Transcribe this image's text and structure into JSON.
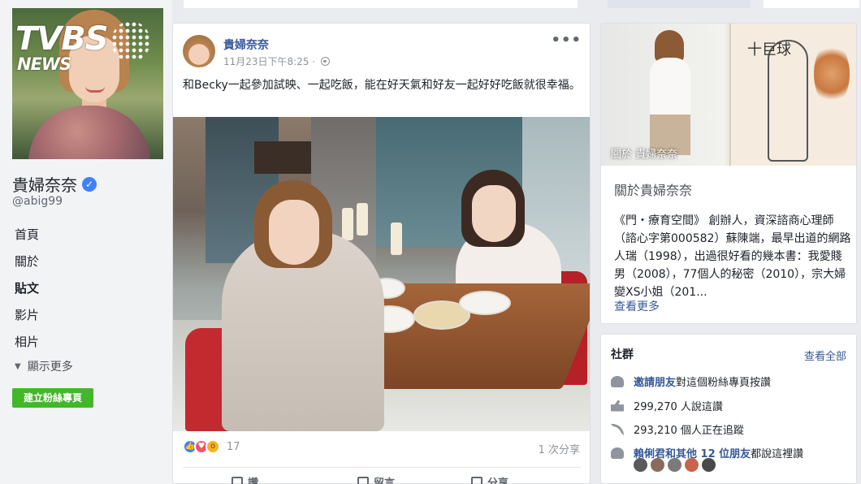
{
  "cover": {
    "logo_main": "TVBS",
    "logo_sub": "NEWS"
  },
  "page": {
    "name": "貴婦奈奈",
    "verified_icon": "check",
    "handle": "@abig99"
  },
  "nav": {
    "items": [
      {
        "label": "首頁",
        "active": false
      },
      {
        "label": "關於",
        "active": false
      },
      {
        "label": "貼文",
        "active": true
      },
      {
        "label": "影片",
        "active": false
      },
      {
        "label": "相片",
        "active": false
      }
    ],
    "see_more": "顯示更多",
    "create_page": "建立粉絲專頁"
  },
  "post": {
    "author": "貴婦奈奈",
    "time": "11月23日下午8:25 ·",
    "menu": "•••",
    "text": "和Becky一起參加試映、一起吃飯，能在好天氣和好友一起好好吃飯就很幸福。",
    "reaction_count": "17",
    "share_count": "1 次分享",
    "actions": [
      "讚",
      "留言",
      "分享"
    ]
  },
  "about": {
    "image_caption": "關於 貴婦奈奈",
    "sketch_title": "十巨球",
    "title": "關於貴婦奈奈",
    "text": "《門・療育空間》 創辦人，資深諮商心理師（諮心字第000582）蘇陳端，最早出道的網路人瑞（1998），出過很好看的幾本書：我愛賤男（2008），77個人的秘密（2010），宗大婦變XS小姐（201...",
    "see_more": "查看更多"
  },
  "community": {
    "title": "社群",
    "see_all": "查看全部",
    "invite_link": "邀請朋友",
    "invite_rest": "對這個粉絲專頁按讚",
    "likes": "299,270 人說這讚",
    "follows": "293,210 個人正在追蹤",
    "friends_link": "賴俐君和其他 12 位朋友",
    "friends_rest": "都說這裡讚"
  },
  "colors": {
    "link": "#365899",
    "green_button": "#42b72a",
    "verified": "#4080ff",
    "background": "#e9ebee"
  }
}
